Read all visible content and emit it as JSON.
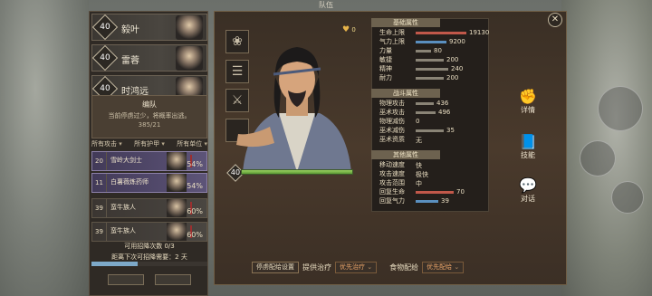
{
  "window_title": "队伍",
  "gold": {
    "icon": "heart-icon",
    "value": "0"
  },
  "close_icon": "close-icon",
  "heroes": [
    {
      "level": "40",
      "name": "毅叶"
    },
    {
      "level": "40",
      "name": "雷蓉"
    },
    {
      "level": "40",
      "name": "时鸿远"
    }
  ],
  "squad": {
    "title": "编队",
    "note": "当前停虏过少，将概率出逃。",
    "count": "385/21"
  },
  "filters": [
    "所有攻击",
    "所有护甲",
    "所有单位"
  ],
  "troops": [
    {
      "num": "20",
      "name": "雪岭大剑士",
      "percent": "54%",
      "selected": true
    },
    {
      "num": "11",
      "name": "白薯薇炼药师",
      "percent": "54%",
      "selected": true
    },
    {
      "num": "39",
      "name": "蛮牛族人",
      "percent": "60%",
      "selected": false
    },
    {
      "num": "39",
      "name": "蛮牛族人",
      "percent": "60%",
      "selected": false
    }
  ],
  "recruit": {
    "line1": "可用招降次数 0/3",
    "line2": "距离下次可招降需要：2 天",
    "progress": 0.4
  },
  "main_hero": {
    "level": "40",
    "xp_fill": 1.0
  },
  "equipment": [
    "flower-emblem-icon",
    "scroll-icon",
    "dagger-icon",
    "empty-slot-icon"
  ],
  "base_attrs": {
    "title": "基础属性",
    "stats": [
      {
        "label": "生命上限",
        "value": "19130",
        "bar": 1.0,
        "color": "red"
      },
      {
        "label": "气力上限",
        "value": "9200",
        "bar": 0.6,
        "color": "blue"
      },
      {
        "label": "力量",
        "value": "80",
        "bar": 0.3,
        "color": "grey"
      },
      {
        "label": "敏捷",
        "value": "200",
        "bar": 0.55,
        "color": "grey"
      },
      {
        "label": "精神",
        "value": "240",
        "bar": 0.65,
        "color": "grey"
      },
      {
        "label": "耐力",
        "value": "200",
        "bar": 0.55,
        "color": "grey"
      }
    ]
  },
  "combat_attrs": {
    "title": "战斗属性",
    "stats": [
      {
        "label": "物理攻击",
        "value": "436",
        "bar": 0.35,
        "color": "grey"
      },
      {
        "label": "巫术攻击",
        "value": "496",
        "bar": 0.4,
        "color": "grey"
      },
      {
        "label": "物理减伤",
        "value": "0",
        "bar": 0,
        "color": "grey"
      },
      {
        "label": "巫术减伤",
        "value": "35",
        "bar": 0.55,
        "color": "grey"
      },
      {
        "label": "巫术资质",
        "value": "无",
        "bar": 0,
        "color": "grey"
      }
    ]
  },
  "other_attrs": {
    "title": "其他属性",
    "stats": [
      {
        "label": "移动速度",
        "value": "快"
      },
      {
        "label": "攻击速度",
        "value": "极快"
      },
      {
        "label": "攻击范围",
        "value": "中"
      },
      {
        "label": "回复生命",
        "value": "70",
        "bar": 0.75,
        "color": "red"
      },
      {
        "label": "回复气力",
        "value": "39",
        "bar": 0.45,
        "color": "blue"
      }
    ]
  },
  "side_actions": [
    {
      "icon": "fist-icon",
      "label": "详情"
    },
    {
      "icon": "book-flame-icon",
      "label": "技能"
    },
    {
      "icon": "speech-bubble-icon",
      "label": "对话"
    }
  ],
  "bottom": {
    "config_button": "停虏配给设置",
    "treat_label": "提供治疗",
    "treat_option": "优先治疗",
    "food_label": "食物配给",
    "food_option": "优先配给"
  },
  "colors": {
    "hp": "#c1584a",
    "mp": "#5a8fbf",
    "xp": "#7ab84a",
    "panel": "#3a2f25",
    "accent": "#6d624f"
  }
}
